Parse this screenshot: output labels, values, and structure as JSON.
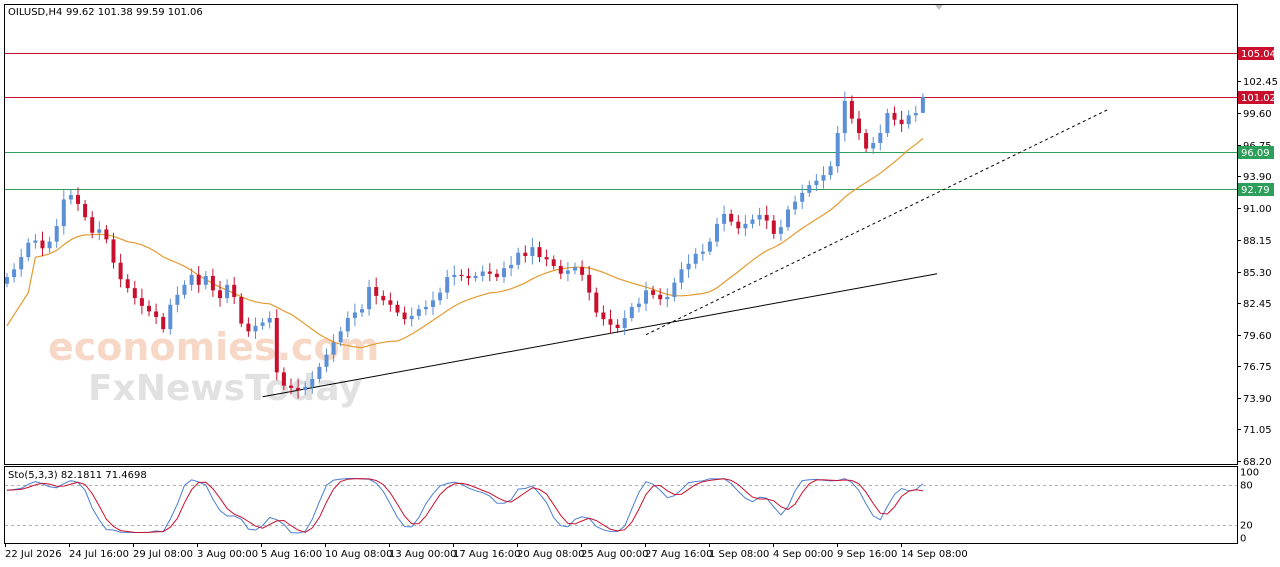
{
  "header": {
    "symbol_tf": "OILUSD,H4",
    "ohlc": "99.62 101.38 99.59 101.06"
  },
  "watermark": {
    "line1": "economies.com",
    "line2": "FxNewsToday"
  },
  "colors": {
    "bull": "#5b8fd6",
    "bear": "#c8102e",
    "ma": "#e39a2e",
    "resistance": "#c8102e",
    "support": "#2e9e5b",
    "stoch_main": "#4a7fd0",
    "stoch_signal": "#c8102e"
  },
  "stoch": {
    "label": "Sto(5,3,3) 82.1811 71.4698",
    "axis_ticks": [
      "100",
      "80",
      "20",
      "0"
    ],
    "levels": [
      80,
      20
    ]
  },
  "chart_data": {
    "type": "candlestick",
    "symbol": "OILUSD",
    "timeframe": "H4",
    "ylim": [
      68.2,
      108.0
    ],
    "y_ticks": [
      68.2,
      71.05,
      73.9,
      76.75,
      79.6,
      82.45,
      85.3,
      88.15,
      91.0,
      93.9,
      96.75,
      99.6,
      102.45
    ],
    "y_tick_labels": [
      "68.20",
      "71.05",
      "73.90",
      "76.75",
      "79.60",
      "82.45",
      "85.30",
      "88.15",
      "91.00",
      "93.90",
      "96.75",
      "99.60",
      "102.45"
    ],
    "x_labels": [
      "22 Jul 2026",
      "24 Jul 16:00",
      "29 Jul 08:00",
      "3 Aug 00:00",
      "5 Aug 16:00",
      "10 Aug 08:00",
      "13 Aug 00:00",
      "17 Aug 16:00",
      "20 Aug 08:00",
      "25 Aug 00:00",
      "27 Aug 16:00",
      "1 Sep 08:00",
      "4 Sep 00:00",
      "9 Sep 16:00",
      "14 Sep 08:00"
    ],
    "horizontal_levels": [
      {
        "value": 105.04,
        "label": "105.04",
        "kind": "resistance"
      },
      {
        "value": 101.02,
        "label": "101.02",
        "kind": "resistance"
      },
      {
        "value": 96.09,
        "label": "96.09",
        "kind": "support"
      },
      {
        "value": 92.79,
        "label": "92.79",
        "kind": "support"
      }
    ],
    "trendlines": [
      {
        "style": "solid",
        "from": {
          "bar": 36,
          "price": 74.0
        },
        "to": {
          "bar": 131,
          "price": 85.1
        }
      },
      {
        "style": "dashed",
        "from": {
          "bar": 90,
          "price": 79.6
        },
        "to": {
          "bar": 155,
          "price": 99.9
        }
      }
    ],
    "last_ohlc": {
      "open": 99.62,
      "high": 101.38,
      "low": 99.59,
      "close": 101.06
    },
    "closes": [
      84.8,
      85.5,
      86.6,
      87.9,
      88.1,
      87.4,
      88.0,
      89.4,
      91.8,
      92.2,
      91.4,
      90.2,
      88.8,
      89.1,
      88.2,
      86.1,
      84.6,
      83.8,
      82.9,
      82.2,
      81.7,
      81.2,
      80.1,
      82.3,
      83.2,
      84.1,
      85.0,
      84.1,
      84.9,
      83.6,
      82.9,
      84.1,
      83.0,
      80.6,
      79.9,
      80.4,
      80.7,
      81.1,
      76.2,
      75.0,
      74.8,
      74.6,
      74.9,
      75.6,
      76.7,
      77.8,
      78.9,
      79.9,
      81.1,
      81.6,
      81.9,
      83.9,
      83.1,
      82.7,
      82.3,
      81.6,
      81.0,
      81.3,
      81.9,
      82.1,
      82.7,
      83.4,
      84.8,
      85.0,
      84.9,
      84.7,
      84.9,
      85.3,
      85.1,
      84.8,
      85.6,
      85.9,
      87.0,
      86.7,
      87.5,
      86.6,
      86.4,
      85.8,
      85.1,
      85.4,
      85.7,
      85.0,
      83.4,
      81.6,
      81.0,
      80.5,
      80.2,
      81.1,
      82.1,
      82.4,
      83.6,
      83.2,
      82.8,
      83.0,
      84.3,
      85.5,
      86.0,
      86.9,
      87.1,
      88.0,
      89.6,
      90.5,
      89.8,
      89.2,
      89.6,
      90.0,
      90.4,
      89.9,
      88.7,
      89.3,
      90.9,
      91.6,
      92.4,
      93.1,
      93.5,
      94.0,
      94.8,
      97.8,
      100.7,
      99.1,
      97.8,
      96.4,
      96.9,
      97.8,
      99.6,
      99.0,
      98.6,
      99.4,
      99.6,
      101.06
    ]
  }
}
